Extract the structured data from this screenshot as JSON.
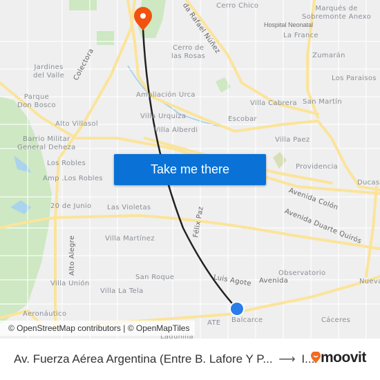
{
  "map": {
    "labels": [
      "Cerro Chico",
      "Marqués de\nSobremonte Anexo",
      "Hospital Neonatal",
      "La France",
      "Zumarán",
      "Los Paraisos",
      "Cerro de\nlas Rosas",
      "Jardines\ndel Valle",
      "Parque\nDon Bosco",
      "Ampliación Urca",
      "Villa Cabrera",
      "San Martín",
      "Villa Urquiza",
      "Escobar",
      "Alto Villasol",
      "Villa Alberdi",
      "Barrio Militar\nGeneral Deheza",
      "Villa Paez",
      "Los Robles",
      "Amp .Los Robles",
      "Providencia",
      "Ducasse",
      "20 de Junio",
      "Las Violetas",
      "Villa Martínez",
      "San Roque",
      "Observatorio",
      "Villa Unión",
      "Villa La Tela",
      "Nueva",
      "Aeronáutico",
      "Balcarce",
      "Cáceres",
      "Lagunilla",
      "ATE"
    ],
    "roads": [
      "Colectora",
      "da Rafael Núñez",
      "Avenida Colón",
      "Avenida Duarte Quirós",
      "Félix Paz",
      "Luis Agote",
      "Avenida",
      "Alto Alegre"
    ],
    "origin_marker": {
      "icon": "current-location-dot-icon",
      "color": "#2b7de9"
    },
    "destination_marker": {
      "icon": "map-pin-icon",
      "color": "#f1520f"
    },
    "route_color": "#222222"
  },
  "cta": {
    "label": "Take me there",
    "color": "#0a72d6"
  },
  "attribution": "© OpenStreetMap contributors | © OpenMapTiles",
  "footer": {
    "route_from": "Av. Fuerza Aérea Argentina (Entre B. Lafore Y P...",
    "arrow_icon": "arrow-right-icon",
    "route_to": "I...",
    "brand": "moovit",
    "brand_color": "#f26b21"
  }
}
